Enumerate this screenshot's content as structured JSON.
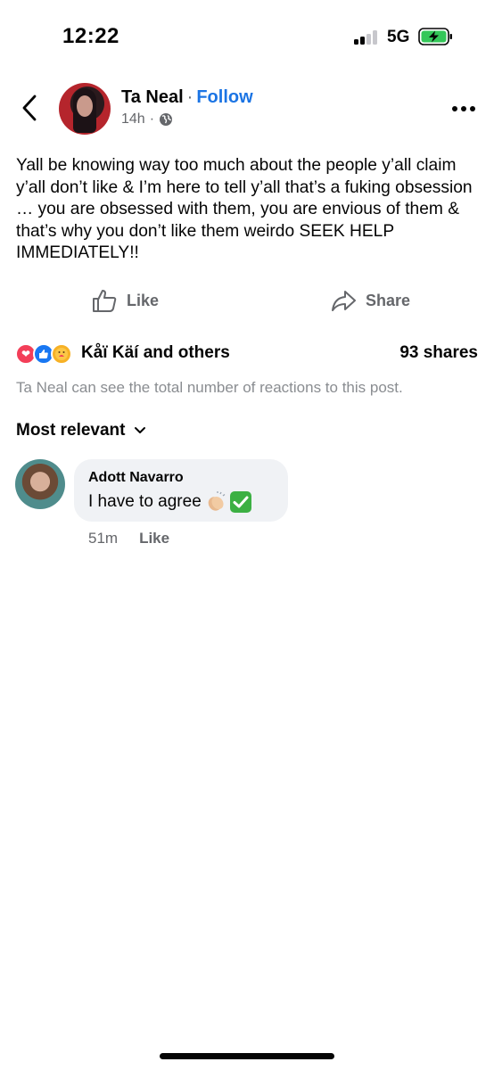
{
  "status_bar": {
    "time": "12:22",
    "network": "5G",
    "battery_color": "#34c759"
  },
  "post": {
    "author": "Ta Neal",
    "separator": "·",
    "follow_label": "Follow",
    "age": "14h",
    "age_separator": "·",
    "audience_icon": "globe-icon",
    "body": "Yall be knowing way too much about the people y’all claim y’all don’t like & I’m here to tell y’all that’s a fuking obsession … you are obsessed with them, you are envious of them & that’s why you don’t like them weirdo SEEK HELP IMMEDIATELY!!",
    "actions": {
      "like_label": "Like",
      "share_label": "Share"
    },
    "reactions": {
      "icons": [
        "love-icon",
        "like-icon",
        "care-icon"
      ],
      "reactors_text": "Kåï Käí and others",
      "shares_text": "93 shares",
      "note": "Ta Neal can see the total number of reactions to this post."
    }
  },
  "comments_section": {
    "sort_label": "Most relevant",
    "comments": [
      {
        "author": "Adott Navarro",
        "text": "I have to agree",
        "emoji": [
          "clapping-hands-icon",
          "check-mark-icon"
        ],
        "age": "51m",
        "like_label": "Like"
      }
    ]
  },
  "colors": {
    "accent": "#1b74e4",
    "secondary_text": "#65676b",
    "note_text": "#8a8d91",
    "bubble": "#f0f2f5"
  }
}
